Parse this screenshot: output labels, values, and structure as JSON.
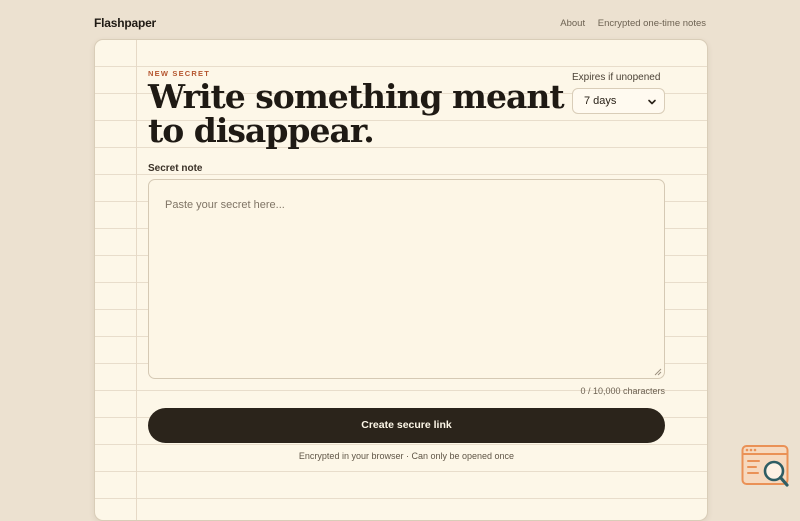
{
  "header": {
    "brand": "Flashpaper",
    "nav": [
      "About",
      "Encrypted one-time notes"
    ]
  },
  "form": {
    "kicker": "NEW SECRET",
    "headline": "Write something meant to disappear.",
    "expires": {
      "label": "Expires if unopened",
      "selected": "7 days"
    },
    "note": {
      "label": "Secret note",
      "placeholder": "Paste your secret here..."
    },
    "char_count": "0 / 10,000 characters",
    "submit_label": "Create secure link",
    "footnote": "Encrypted in your browser · Can only be opened once"
  },
  "colors": {
    "background": "#ece1d0",
    "card": "#fdf7e8",
    "accent": "#b5562f",
    "button": "#2b241b"
  },
  "icons": {
    "select": "chevron-down-icon",
    "textarea": "resize-handle-icon",
    "corner": "search-browser-logo-icon"
  }
}
